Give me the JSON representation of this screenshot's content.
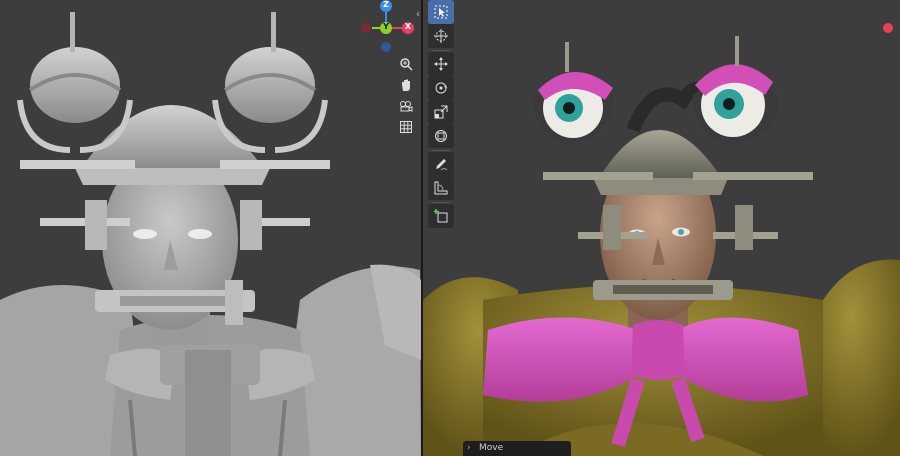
{
  "operator_panel": {
    "label": "Move",
    "expand_glyph": "›"
  },
  "gizmo": {
    "x_label": "X",
    "y_label": "Y",
    "z_label": "Z"
  },
  "colors": {
    "viewport_bg": "#3d3d3d",
    "axis_x": "#e8405a",
    "axis_y": "#8bd32b",
    "axis_z": "#3c8ee8",
    "active_tool": "#4a6fa8",
    "bow_pink": "#d34fb8",
    "eye_iris": "#2fa39a",
    "suit_olive": "#8a7a2a"
  },
  "left_viewport_tools": [
    {
      "name": "zoom",
      "icon": "magnifier-plus-icon"
    },
    {
      "name": "pan",
      "icon": "hand-icon"
    },
    {
      "name": "camera",
      "icon": "camera-icon"
    },
    {
      "name": "perspective",
      "icon": "grid-icon"
    }
  ],
  "toolbar_tools": [
    {
      "name": "select-box",
      "icon": "cursor-icon",
      "active": true
    },
    {
      "name": "cursor",
      "icon": "crosshair-circle-icon",
      "active": false
    },
    {
      "name": "move",
      "icon": "move-arrows-icon",
      "active": false
    },
    {
      "name": "rotate",
      "icon": "rotate-icon",
      "active": false
    },
    {
      "name": "scale",
      "icon": "scale-icon",
      "active": false
    },
    {
      "name": "transform",
      "icon": "transform-icon",
      "active": false
    },
    {
      "name": "annotate",
      "icon": "pencil-icon",
      "active": false
    },
    {
      "name": "measure",
      "icon": "ruler-icon",
      "active": false
    },
    {
      "name": "add-cube",
      "icon": "add-cube-icon",
      "active": false
    }
  ]
}
